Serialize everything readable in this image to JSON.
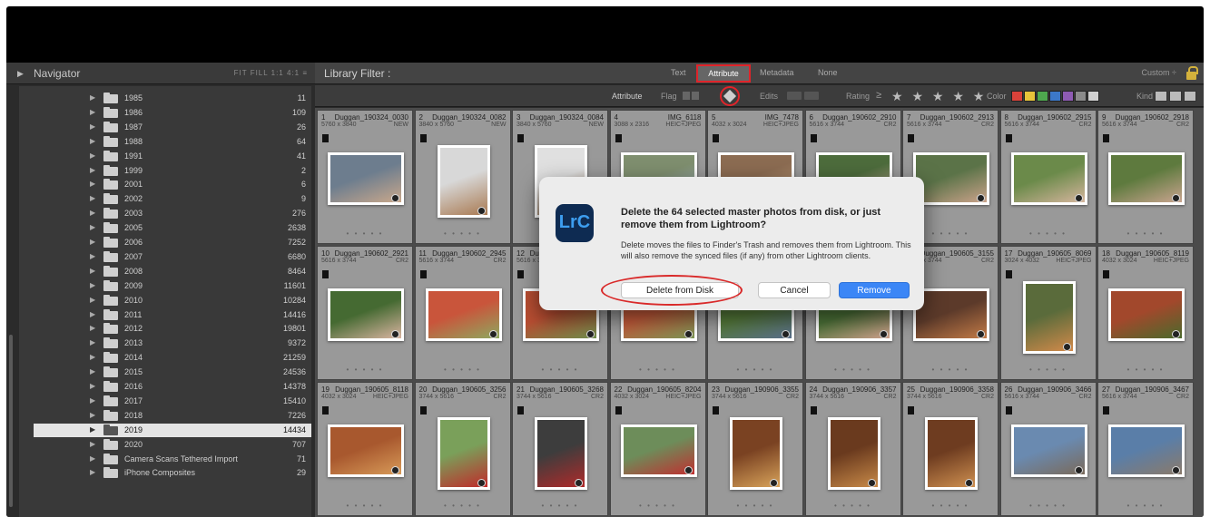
{
  "navigator": {
    "title": "Navigator",
    "zoom_options": "FIT  FILL  1:1  4:1  ≡"
  },
  "folders": [
    {
      "name": "1985",
      "count": "11"
    },
    {
      "name": "1986",
      "count": "109"
    },
    {
      "name": "1987",
      "count": "26"
    },
    {
      "name": "1988",
      "count": "64"
    },
    {
      "name": "1991",
      "count": "41"
    },
    {
      "name": "1999",
      "count": "2"
    },
    {
      "name": "2001",
      "count": "6"
    },
    {
      "name": "2002",
      "count": "9"
    },
    {
      "name": "2003",
      "count": "276"
    },
    {
      "name": "2005",
      "count": "2638"
    },
    {
      "name": "2006",
      "count": "7252"
    },
    {
      "name": "2007",
      "count": "6680"
    },
    {
      "name": "2008",
      "count": "8464"
    },
    {
      "name": "2009",
      "count": "11601"
    },
    {
      "name": "2010",
      "count": "10284"
    },
    {
      "name": "2011",
      "count": "14416"
    },
    {
      "name": "2012",
      "count": "19801"
    },
    {
      "name": "2013",
      "count": "9372"
    },
    {
      "name": "2014",
      "count": "21259"
    },
    {
      "name": "2015",
      "count": "24536"
    },
    {
      "name": "2016",
      "count": "14378"
    },
    {
      "name": "2017",
      "count": "15410"
    },
    {
      "name": "2018",
      "count": "7226"
    },
    {
      "name": "2019",
      "count": "14434",
      "selected": true
    },
    {
      "name": "2020",
      "count": "707"
    },
    {
      "name": "Camera Scans Tethered Import",
      "count": "71"
    },
    {
      "name": "iPhone Composites",
      "count": "29"
    }
  ],
  "library_filter": {
    "title": "Library Filter :",
    "tabs": [
      "Text",
      "Attribute",
      "Metadata",
      "None"
    ],
    "active_tab": "Attribute",
    "preset": "Custom ÷"
  },
  "attribute_bar": {
    "label": "Attribute",
    "flag": "Flag",
    "edits": "Edits",
    "rating": "Rating",
    "rating_op": "≥",
    "stars": "★ ★ ★ ★ ★",
    "color": "Color",
    "kind": "Kind",
    "swatch_colors": [
      "#d9423a",
      "#e8c43a",
      "#4ea84e",
      "#3c78c8",
      "#8e5bb3",
      "#8a8a8a",
      "#cfcfcf"
    ]
  },
  "thumbnails": [
    {
      "index": "1",
      "name": "Duggan_190324_0030",
      "meta": "5760 x 3840",
      "ext": "NEW"
    },
    {
      "index": "2",
      "name": "Duggan_190324_0082",
      "meta": "3840 x 5760",
      "ext": "NEW"
    },
    {
      "index": "3",
      "name": "Duggan_190324_0084",
      "meta": "3840 x 5760",
      "ext": "NEW"
    },
    {
      "index": "4",
      "name": "IMG_6118",
      "meta": "3088 x 2316",
      "ext": "HEIC+JPEG"
    },
    {
      "index": "5",
      "name": "IMG_7478",
      "meta": "4032 x 3024",
      "ext": "HEIC+JPEG"
    },
    {
      "index": "6",
      "name": "Duggan_190602_2910",
      "meta": "5616 x 3744",
      "ext": "CR2"
    },
    {
      "index": "7",
      "name": "Duggan_190602_2913",
      "meta": "5616 x 3744",
      "ext": "CR2"
    },
    {
      "index": "8",
      "name": "Duggan_190602_2915",
      "meta": "5616 x 3744",
      "ext": "CR2"
    },
    {
      "index": "9",
      "name": "Duggan_190602_2918",
      "meta": "5616 x 3744",
      "ext": "CR2"
    },
    {
      "index": "10",
      "name": "Duggan_190602_2921",
      "meta": "5616 x 3744",
      "ext": "CR2"
    },
    {
      "index": "11",
      "name": "Duggan_190602_2945",
      "meta": "5616 x 3744",
      "ext": "CR2"
    },
    {
      "index": "12",
      "name": "Duggan_190602_2950",
      "meta": "5616 x 3744",
      "ext": "CR2"
    },
    {
      "index": "13",
      "name": "",
      "meta": "",
      "ext": ""
    },
    {
      "index": "14",
      "name": "",
      "meta": "",
      "ext": ""
    },
    {
      "index": "15",
      "name": "",
      "meta": "",
      "ext": ""
    },
    {
      "index": "16",
      "name": "Duggan_190605_3155",
      "meta": "5616 x 3744",
      "ext": "CR2"
    },
    {
      "index": "17",
      "name": "Duggan_190605_8069",
      "meta": "3024 x 4032",
      "ext": "HEIC+JPEG"
    },
    {
      "index": "18",
      "name": "Duggan_190605_8119",
      "meta": "4032 x 3024",
      "ext": "HEIC+JPEG"
    },
    {
      "index": "19",
      "name": "Duggan_190605_8118",
      "meta": "4032 x 3024",
      "ext": "HEIC+JPEG"
    },
    {
      "index": "20",
      "name": "Duggan_190605_3256",
      "meta": "3744 x 5616",
      "ext": "CR2"
    },
    {
      "index": "21",
      "name": "Duggan_190605_3268",
      "meta": "3744 x 5616",
      "ext": "CR2"
    },
    {
      "index": "22",
      "name": "Duggan_190605_8204",
      "meta": "4032 x 3024",
      "ext": "HEIC+JPEG"
    },
    {
      "index": "23",
      "name": "Duggan_190906_3355",
      "meta": "3744 x 5616",
      "ext": "CR2"
    },
    {
      "index": "24",
      "name": "Duggan_190906_3357",
      "meta": "3744 x 5616",
      "ext": "CR2"
    },
    {
      "index": "25",
      "name": "Duggan_190906_3358",
      "meta": "3744 x 5616",
      "ext": "CR2"
    },
    {
      "index": "26",
      "name": "Duggan_190906_3466",
      "meta": "5616 x 3744",
      "ext": "CR2"
    },
    {
      "index": "27",
      "name": "Duggan_190906_3467",
      "meta": "5616 x 3744",
      "ext": "CR2"
    }
  ],
  "dialog": {
    "title": "Delete the 64 selected master photos from disk, or just remove them from Lightroom?",
    "body": "Delete moves the files to Finder's Trash and removes them from Lightroom.  This will also remove the synced files (if any) from other Lightroom clients.",
    "app_icon_text": "LrC",
    "delete_label": "Delete from Disk",
    "cancel_label": "Cancel",
    "remove_label": "Remove"
  }
}
